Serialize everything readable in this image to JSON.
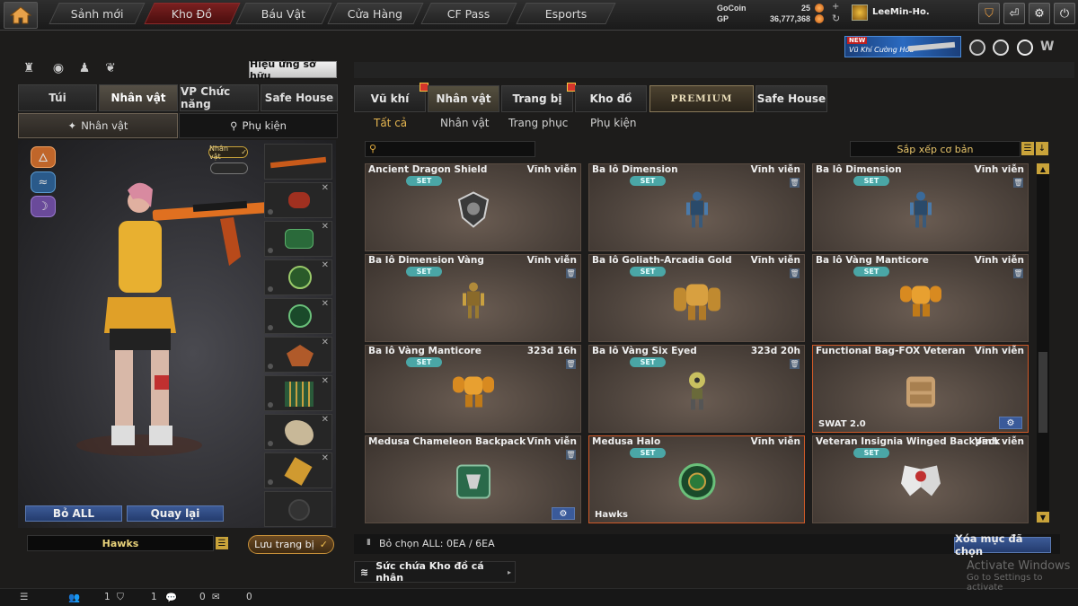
{
  "nav": {
    "tabs": [
      {
        "label": "Sảnh mới",
        "active": false
      },
      {
        "label": "Kho Đồ",
        "active": true
      },
      {
        "label": "Báu Vật",
        "active": false
      },
      {
        "label": "Cửa Hàng",
        "active": false
      },
      {
        "label": "CF Pass",
        "active": false
      },
      {
        "label": "Esports",
        "active": false
      }
    ]
  },
  "currency": {
    "gocoin_label": "GoCoin",
    "gocoin_value": "25",
    "gp_label": "GP",
    "gp_value": "36,777,368",
    "username": "LeeMin-Ho."
  },
  "banner": {
    "badge": "NEW",
    "text": "Vũ Khí Cường Hóa"
  },
  "left": {
    "effect_button": "Hiệu ứng sở hữu",
    "tabs": [
      {
        "label": "Túi",
        "active": false
      },
      {
        "label": "Nhân vật",
        "active": true
      },
      {
        "label": "VP Chức năng",
        "active": false
      },
      {
        "label": "Safe House",
        "active": false
      }
    ],
    "subtabs": [
      {
        "label": "Nhân vật",
        "active": true
      },
      {
        "label": "Phụ kiện",
        "active": false
      }
    ],
    "character_tag": "Nhân vật",
    "remove_all": "Bỏ ALL",
    "back": "Quay lại",
    "character_name": "Hawks",
    "save_button": "Lưu trang bị"
  },
  "right": {
    "tabs": [
      {
        "label": "Vũ khí",
        "gift": true,
        "active": false
      },
      {
        "label": "Nhân vật",
        "gift": false,
        "active": true
      },
      {
        "label": "Trang bị",
        "gift": true,
        "active": false
      },
      {
        "label": "Kho đồ",
        "gift": false,
        "active": false
      },
      {
        "label": "PREMIUM",
        "gift": false,
        "active": false
      },
      {
        "label": "Safe House",
        "gift": false,
        "active": false
      }
    ],
    "filters": [
      {
        "label": "Tất cả",
        "active": true
      },
      {
        "label": "Nhân vật",
        "active": false
      },
      {
        "label": "Trang phục",
        "active": false
      },
      {
        "label": "Phụ kiện",
        "active": false
      }
    ],
    "search_placeholder": "",
    "sort_label": "Sắp xếp cơ bản",
    "items": [
      {
        "name": "Ancient Dragon Shield",
        "duration": "Vĩnh viễn",
        "set": "SET",
        "trash": false,
        "gear": false,
        "tag": "",
        "art": "shield",
        "highlight": false
      },
      {
        "name": "Ba lô Dimension",
        "duration": "Vĩnh viễn",
        "set": "SET",
        "trash": true,
        "gear": false,
        "tag": "",
        "art": "robot-blue",
        "highlight": false
      },
      {
        "name": "Ba lô Dimension",
        "duration": "Vĩnh viễn",
        "set": "SET",
        "trash": true,
        "gear": false,
        "tag": "",
        "art": "robot-blue",
        "highlight": false
      },
      {
        "name": "Ba lô Dimension Vàng",
        "duration": "Vĩnh viễn",
        "set": "SET",
        "trash": true,
        "gear": false,
        "tag": "",
        "art": "robot-gold-small",
        "highlight": false
      },
      {
        "name": "Ba lô Goliath-Arcadia Gold",
        "duration": "Vĩnh viễn",
        "set": "SET",
        "trash": true,
        "gear": false,
        "tag": "",
        "art": "golem-gold",
        "highlight": false
      },
      {
        "name": "Ba lô Vàng Manticore",
        "duration": "Vĩnh viễn",
        "set": "SET",
        "trash": true,
        "gear": false,
        "tag": "",
        "art": "golem-orange",
        "highlight": false
      },
      {
        "name": "Ba lô Vàng Manticore",
        "duration": "323d 16h",
        "set": "SET",
        "trash": true,
        "gear": false,
        "tag": "",
        "art": "golem-orange",
        "highlight": false
      },
      {
        "name": "Ba lô Vàng Six Eyed",
        "duration": "323d 20h",
        "set": "SET",
        "trash": true,
        "gear": false,
        "tag": "",
        "art": "robot-yellow",
        "highlight": false
      },
      {
        "name": "Functional Bag-FOX Veteran",
        "duration": "Vĩnh viễn",
        "set": "",
        "trash": false,
        "gear": true,
        "tag": "SWAT 2.0",
        "art": "bag",
        "highlight": true
      },
      {
        "name": "Medusa Chameleon Backpack",
        "duration": "Vĩnh viễn",
        "set": "",
        "trash": true,
        "gear": true,
        "tag": "",
        "art": "green-pack",
        "highlight": false
      },
      {
        "name": "Medusa Halo",
        "duration": "Vĩnh viễn",
        "set": "SET",
        "trash": false,
        "gear": false,
        "tag": "Hawks",
        "art": "halo",
        "highlight": true
      },
      {
        "name": "Veteran Insignia Winged Backpack",
        "duration": "Vĩnh viễn",
        "set": "SET",
        "trash": false,
        "gear": false,
        "tag": "",
        "art": "wings",
        "highlight": false
      }
    ],
    "selected_text": "Bỏ chọn ALL: 0EA / 6EA",
    "clear_button": "Xóa mục đã chọn",
    "capacity_label": "Sức chứa Kho đồ cá nhân"
  },
  "status": {
    "v1": "1",
    "v2": "1",
    "v3": "0",
    "v4": "0"
  },
  "watermark": {
    "title": "Activate Windows",
    "subtitle": "Go to Settings to activate"
  },
  "colors": {
    "accent_gold": "#e6b650",
    "set_badge": "#4aa6a6",
    "active_nav": "#7a2020"
  }
}
